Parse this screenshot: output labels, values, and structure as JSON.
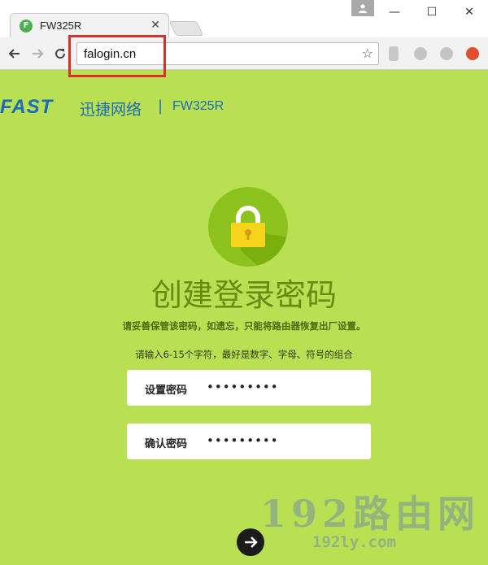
{
  "browser": {
    "tab_title": "FW325R",
    "favicon_letter": "F",
    "tab_close": "✕",
    "address": "falogin.cn",
    "window_minimize": "—",
    "window_maximize": "☐",
    "window_close": "✕",
    "icons": [
      "back-icon",
      "forward-icon",
      "reload-icon",
      "star-icon",
      "profile-icon"
    ]
  },
  "brand": {
    "logo": "FAST",
    "name_cn": "迅捷网络",
    "separator": "|",
    "model": "FW325R",
    "color": "#1d6bb8"
  },
  "page": {
    "title": "创建登录密码",
    "notice": "请妥善保管该密码，如遗忘，只能将路由器恢复出厂设置。",
    "instruction": "请输入6-15个字符，最好是数字、字母、符号的组合",
    "background_color": "#b9df52"
  },
  "form": {
    "password_label": "设置密码",
    "password_value": "•••••••••",
    "confirm_label": "确认密码",
    "confirm_value": "•••••••••"
  },
  "watermark": {
    "main": "192路由网",
    "sub": "192ly.com"
  }
}
